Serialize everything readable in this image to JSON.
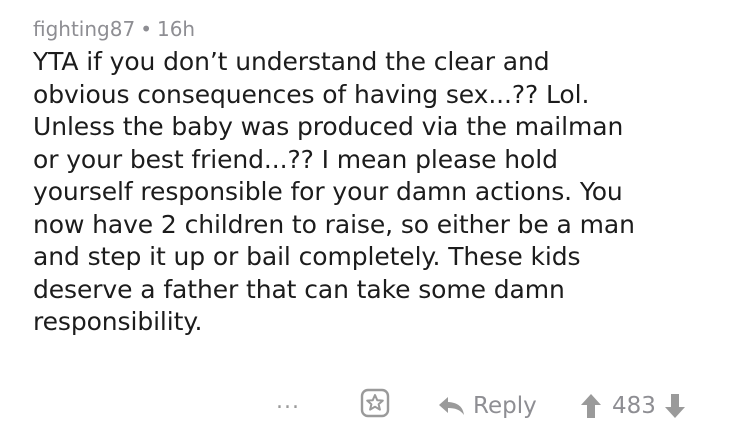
{
  "comment": {
    "author": "fighting87",
    "separator": "•",
    "age": "16h",
    "body_lines": [
      "YTA if you don’t understand the clear and",
      "obvious consequences of having sex...?? Lol.",
      "Unless the baby was produced via the mailman",
      "or your best friend...?? I mean please hold",
      "yourself responsible for your damn actions. You",
      "now have 2 children to raise, so either be a man",
      "and step it up or bail completely. These kids",
      "deserve a father that can take some damn",
      "responsibility."
    ]
  },
  "actions": {
    "more_label": "...",
    "reply_label": "Reply",
    "score": "483"
  },
  "icons": {
    "more": "more-dots-icon",
    "award": "award-icon",
    "reply": "reply-arrow-icon",
    "upvote": "upvote-arrow-icon",
    "downvote": "downvote-arrow-icon"
  },
  "colors": {
    "text": "#1c1c1c",
    "muted": "#8e8e93"
  }
}
